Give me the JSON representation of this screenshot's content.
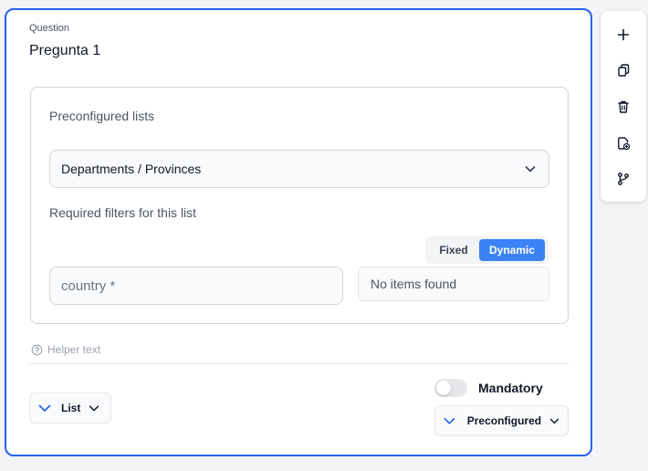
{
  "question": {
    "label": "Question",
    "title": "Pregunta 1"
  },
  "preconfigured": {
    "title": "Preconfigured lists",
    "selected_list": "Departments / Provinces",
    "filters_title": "Required filters for this list",
    "mode_fixed": "Fixed",
    "mode_dynamic": "Dynamic",
    "mode_selected": "Dynamic",
    "filter_placeholder": "country *",
    "no_items": "No items found"
  },
  "helper_text": "Helper text",
  "footer": {
    "type_label": "List",
    "mandatory_label": "Mandatory",
    "mandatory_on": false,
    "source_label": "Preconfigured"
  },
  "toolbar": {
    "items": [
      "plus-icon",
      "duplicate-icon",
      "trash-icon",
      "import-icon",
      "branch-icon"
    ]
  },
  "colors": {
    "accent": "#2563eb",
    "toggle_active": "#3b82f6"
  }
}
